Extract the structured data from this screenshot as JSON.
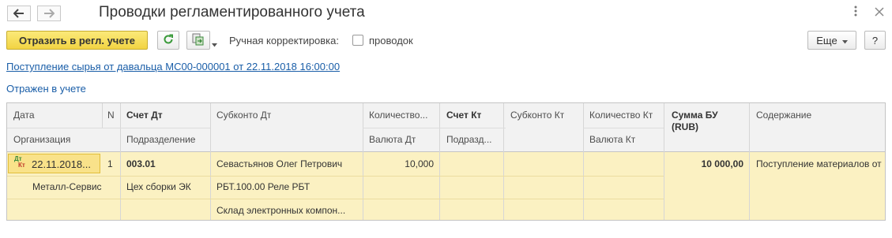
{
  "header": {
    "title": "Проводки регламентированного учета",
    "back_icon": "arrow-left-icon",
    "forward_icon": "arrow-right-icon",
    "more_icon": "kebab-menu-icon",
    "close_icon": "close-icon"
  },
  "toolbar": {
    "primary_label": "Отразить в регл. учете",
    "refresh_icon": "refresh-icon",
    "export_icon": "export-icon",
    "manual_label": "Ручная корректировка:",
    "manual_checkbox_label": "проводок",
    "manual_checked": false,
    "more_label": "Еще",
    "help_label": "?"
  },
  "document": {
    "link": "Поступление сырья от давальца МС00-000001 от 22.11.2018 16:00:00",
    "status": "Отражен в учете"
  },
  "table": {
    "headers": {
      "date": "Дата",
      "n": "N",
      "account_dt": "Счет Дт",
      "subconto_dt": "Субконто Дт",
      "quantity_dt": "Количество...",
      "account_kt": "Счет Кт",
      "subconto_kt": "Субконто Кт",
      "quantity_kt": "Количество Кт",
      "amount": "Сумма БУ",
      "amount_unit": "(RUB)",
      "content": "Содержание",
      "organization": "Организация",
      "division": "Подразделение",
      "currency_dt": "Валюта Дт",
      "division_kt": "Подразд...",
      "currency_kt": "Валюта Кт"
    },
    "row": {
      "icon_dt": "Дт",
      "icon_kt": "Кт",
      "date": "22.11.2018...",
      "n": "1",
      "account_dt": "003.01",
      "subconto_dt_1": "Севастьянов Олег Петрович",
      "subconto_dt_2": "РБТ.100.00 Реле РБТ",
      "subconto_dt_3": "Склад электронных компон...",
      "quantity_dt": "10,000",
      "amount": "10 000,00",
      "content": "Поступление материалов от",
      "organization": "Металл-Сервис",
      "division": "Цех сборки ЭК"
    }
  }
}
